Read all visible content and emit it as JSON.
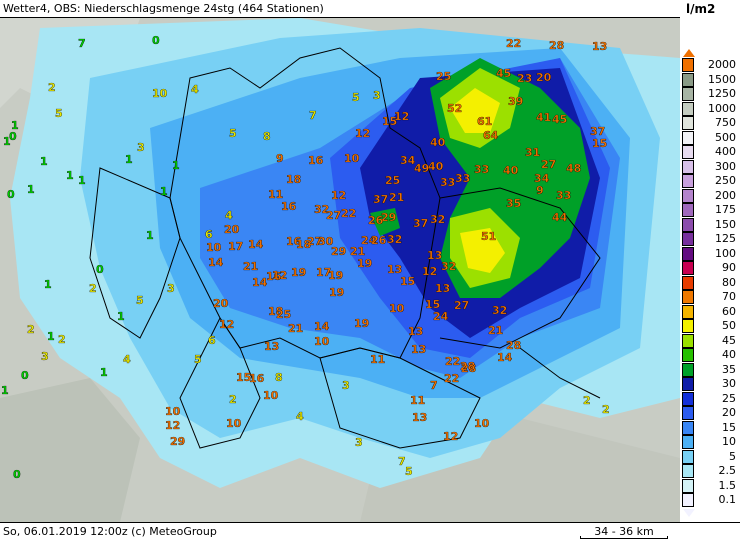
{
  "title": "Wetter4, OBS: Niederschlagsmenge 24stg (464 Stationen)",
  "footer": {
    "left": "So, 06.01.2019 12:00z (c) MeteoGroup",
    "scale": "34 - 36 km"
  },
  "legend": {
    "unit": "l/m2",
    "levels": [
      {
        "label": "2000",
        "color": "#f07000"
      },
      {
        "label": "1500",
        "color": "#8a9a86"
      },
      {
        "label": "1250",
        "color": "#a8b4a4"
      },
      {
        "label": "1000",
        "color": "#c4ccc0"
      },
      {
        "label": "750",
        "color": "#e0e4dc"
      },
      {
        "label": "500",
        "color": "#f2f2f6"
      },
      {
        "label": "400",
        "color": "#e8dcf0"
      },
      {
        "label": "300",
        "color": "#d8c0e8"
      },
      {
        "label": "250",
        "color": "#c8a0dc"
      },
      {
        "label": "200",
        "color": "#b484cc"
      },
      {
        "label": "175",
        "color": "#a068bc"
      },
      {
        "label": "150",
        "color": "#8c4cac"
      },
      {
        "label": "125",
        "color": "#78309c"
      },
      {
        "label": "100",
        "color": "#640c80"
      },
      {
        "label": "90",
        "color": "#c80050"
      },
      {
        "label": "80",
        "color": "#e83c00"
      },
      {
        "label": "70",
        "color": "#f07800"
      },
      {
        "label": "60",
        "color": "#f4b400"
      },
      {
        "label": "50",
        "color": "#f4f000"
      },
      {
        "label": "45",
        "color": "#9ce000"
      },
      {
        "label": "40",
        "color": "#28c000"
      },
      {
        "label": "35",
        "color": "#00a028"
      },
      {
        "label": "30",
        "color": "#101ca8"
      },
      {
        "label": "25",
        "color": "#1430d8"
      },
      {
        "label": "20",
        "color": "#2c5cf0"
      },
      {
        "label": "15",
        "color": "#3a86f4"
      },
      {
        "label": "10",
        "color": "#4cb0f4"
      },
      {
        "label": "5",
        "color": "#78d0f4"
      },
      {
        "label": "2.5",
        "color": "#a8e6f4"
      },
      {
        "label": "1.5",
        "color": "#d4f2f6"
      },
      {
        "label": "0.1",
        "color": "#f2f2ff"
      }
    ]
  },
  "stations": [
    {
      "v": "7",
      "c": "g"
    },
    {
      "v": "0",
      "c": "g"
    },
    {
      "v": "22",
      "c": "o"
    },
    {
      "v": "28",
      "c": "o"
    },
    {
      "v": "13",
      "c": "o"
    },
    {
      "v": "25",
      "c": "o"
    },
    {
      "v": "45",
      "c": "o"
    },
    {
      "v": "23",
      "c": "o"
    },
    {
      "v": "20",
      "c": "o"
    },
    {
      "v": "52",
      "c": "o"
    },
    {
      "v": "61",
      "c": "o"
    },
    {
      "v": "64",
      "c": "o"
    },
    {
      "v": "39",
      "c": "o"
    },
    {
      "v": "41",
      "c": "o"
    },
    {
      "v": "45",
      "c": "o"
    },
    {
      "v": "37",
      "c": "o"
    },
    {
      "v": "15",
      "c": "o"
    },
    {
      "v": "31",
      "c": "o"
    },
    {
      "v": "40",
      "c": "o"
    },
    {
      "v": "27",
      "c": "o"
    },
    {
      "v": "48",
      "c": "o"
    },
    {
      "v": "33",
      "c": "o"
    },
    {
      "v": "34",
      "c": "o"
    },
    {
      "v": "9",
      "c": "o"
    },
    {
      "v": "33",
      "c": "o"
    },
    {
      "v": "35",
      "c": "o"
    },
    {
      "v": "44",
      "c": "o"
    },
    {
      "v": "51",
      "c": "o"
    },
    {
      "v": "32",
      "c": "o"
    },
    {
      "v": "21",
      "c": "o"
    },
    {
      "v": "28",
      "c": "o"
    },
    {
      "v": "14",
      "c": "o"
    },
    {
      "v": "22",
      "c": "o"
    },
    {
      "v": "28",
      "c": "o"
    },
    {
      "v": "10",
      "c": "o"
    },
    {
      "v": "12",
      "c": "o"
    },
    {
      "v": "40",
      "c": "o"
    },
    {
      "v": "34",
      "c": "o"
    },
    {
      "v": "49",
      "c": "o"
    },
    {
      "v": "40",
      "c": "o"
    },
    {
      "v": "33",
      "c": "o"
    },
    {
      "v": "33",
      "c": "o"
    },
    {
      "v": "12",
      "c": "o"
    },
    {
      "v": "15",
      "c": "o"
    },
    {
      "v": "12",
      "c": "o"
    },
    {
      "v": "10",
      "c": "o"
    },
    {
      "v": "16",
      "c": "o"
    },
    {
      "v": "18",
      "c": "o"
    },
    {
      "v": "9",
      "c": "o"
    },
    {
      "v": "11",
      "c": "o"
    },
    {
      "v": "16",
      "c": "o"
    },
    {
      "v": "32",
      "c": "o"
    },
    {
      "v": "27",
      "c": "o"
    },
    {
      "v": "22",
      "c": "o"
    },
    {
      "v": "12",
      "c": "o"
    },
    {
      "v": "37",
      "c": "o"
    },
    {
      "v": "21",
      "c": "o"
    },
    {
      "v": "25",
      "c": "o"
    },
    {
      "v": "29",
      "c": "o"
    },
    {
      "v": "26",
      "c": "o"
    },
    {
      "v": "32",
      "c": "o"
    },
    {
      "v": "37",
      "c": "o"
    },
    {
      "v": "32",
      "c": "o"
    },
    {
      "v": "24",
      "c": "o"
    },
    {
      "v": "26",
      "c": "o"
    },
    {
      "v": "29",
      "c": "o"
    },
    {
      "v": "21",
      "c": "o"
    },
    {
      "v": "19",
      "c": "o"
    },
    {
      "v": "13",
      "c": "o"
    },
    {
      "v": "15",
      "c": "o"
    },
    {
      "v": "13",
      "c": "o"
    },
    {
      "v": "12",
      "c": "o"
    },
    {
      "v": "13",
      "c": "o"
    },
    {
      "v": "32",
      "c": "o"
    },
    {
      "v": "20",
      "c": "o"
    },
    {
      "v": "10",
      "c": "o"
    },
    {
      "v": "14",
      "c": "o"
    },
    {
      "v": "17",
      "c": "o"
    },
    {
      "v": "14",
      "c": "o"
    },
    {
      "v": "16",
      "c": "o"
    },
    {
      "v": "18",
      "c": "o"
    },
    {
      "v": "27",
      "c": "o"
    },
    {
      "v": "30",
      "c": "o"
    },
    {
      "v": "21",
      "c": "o"
    },
    {
      "v": "19",
      "c": "o"
    },
    {
      "v": "17",
      "c": "o"
    },
    {
      "v": "19",
      "c": "o"
    },
    {
      "v": "16",
      "c": "o"
    },
    {
      "v": "14",
      "c": "o"
    },
    {
      "v": "12",
      "c": "o"
    },
    {
      "v": "19",
      "c": "o"
    },
    {
      "v": "20",
      "c": "o"
    },
    {
      "v": "18",
      "c": "o"
    },
    {
      "v": "25",
      "c": "o"
    },
    {
      "v": "21",
      "c": "o"
    },
    {
      "v": "14",
      "c": "o"
    },
    {
      "v": "10",
      "c": "o"
    },
    {
      "v": "19",
      "c": "o"
    },
    {
      "v": "10",
      "c": "o"
    },
    {
      "v": "15",
      "c": "o"
    },
    {
      "v": "27",
      "c": "o"
    },
    {
      "v": "24",
      "c": "o"
    },
    {
      "v": "13",
      "c": "o"
    },
    {
      "v": "13",
      "c": "o"
    },
    {
      "v": "11",
      "c": "o"
    },
    {
      "v": "22",
      "c": "o"
    },
    {
      "v": "28",
      "c": "o"
    },
    {
      "v": "15",
      "c": "o"
    },
    {
      "v": "16",
      "c": "o"
    },
    {
      "v": "13",
      "c": "o"
    },
    {
      "v": "7",
      "c": "o"
    },
    {
      "v": "11",
      "c": "o"
    },
    {
      "v": "13",
      "c": "o"
    },
    {
      "v": "10",
      "c": "o"
    },
    {
      "v": "12",
      "c": "o"
    },
    {
      "v": "10",
      "c": "o"
    },
    {
      "v": "12",
      "c": "o"
    },
    {
      "v": "10",
      "c": "o"
    },
    {
      "v": "29",
      "c": "o"
    },
    {
      "v": "2",
      "c": "y"
    },
    {
      "v": "5",
      "c": "y"
    },
    {
      "v": "10",
      "c": "y"
    },
    {
      "v": "4",
      "c": "y"
    },
    {
      "v": "5",
      "c": "y"
    },
    {
      "v": "3",
      "c": "y"
    },
    {
      "v": "7",
      "c": "y"
    },
    {
      "v": "5",
      "c": "y"
    },
    {
      "v": "8",
      "c": "y"
    },
    {
      "v": "3",
      "c": "y"
    },
    {
      "v": "4",
      "c": "y"
    },
    {
      "v": "6",
      "c": "y"
    },
    {
      "v": "2",
      "c": "y"
    },
    {
      "v": "5",
      "c": "y"
    },
    {
      "v": "3",
      "c": "y"
    },
    {
      "v": "6",
      "c": "y"
    },
    {
      "v": "2",
      "c": "y"
    },
    {
      "v": "4",
      "c": "y"
    },
    {
      "v": "3",
      "c": "y"
    },
    {
      "v": "2",
      "c": "y"
    },
    {
      "v": "5",
      "c": "y"
    },
    {
      "v": "8",
      "c": "y"
    },
    {
      "v": "3",
      "c": "y"
    },
    {
      "v": "2",
      "c": "y"
    },
    {
      "v": "4",
      "c": "y"
    },
    {
      "v": "3",
      "c": "y"
    },
    {
      "v": "7",
      "c": "y"
    },
    {
      "v": "5",
      "c": "y"
    },
    {
      "v": "2",
      "c": "y"
    },
    {
      "v": "2",
      "c": "y"
    },
    {
      "v": "1",
      "c": "g"
    },
    {
      "v": "1",
      "c": "g"
    },
    {
      "v": "0",
      "c": "g"
    },
    {
      "v": "1",
      "c": "g"
    },
    {
      "v": "1",
      "c": "g"
    },
    {
      "v": "1",
      "c": "g"
    },
    {
      "v": "1",
      "c": "g"
    },
    {
      "v": "0",
      "c": "g"
    },
    {
      "v": "1",
      "c": "g"
    },
    {
      "v": "1",
      "c": "g"
    },
    {
      "v": "1",
      "c": "g"
    },
    {
      "v": "0",
      "c": "g"
    },
    {
      "v": "1",
      "c": "g"
    },
    {
      "v": "1",
      "c": "g"
    },
    {
      "v": "1",
      "c": "g"
    },
    {
      "v": "1",
      "c": "g"
    },
    {
      "v": "0",
      "c": "g"
    },
    {
      "v": "1",
      "c": "g"
    },
    {
      "v": "1",
      "c": "g"
    },
    {
      "v": "0",
      "c": "g"
    }
  ]
}
